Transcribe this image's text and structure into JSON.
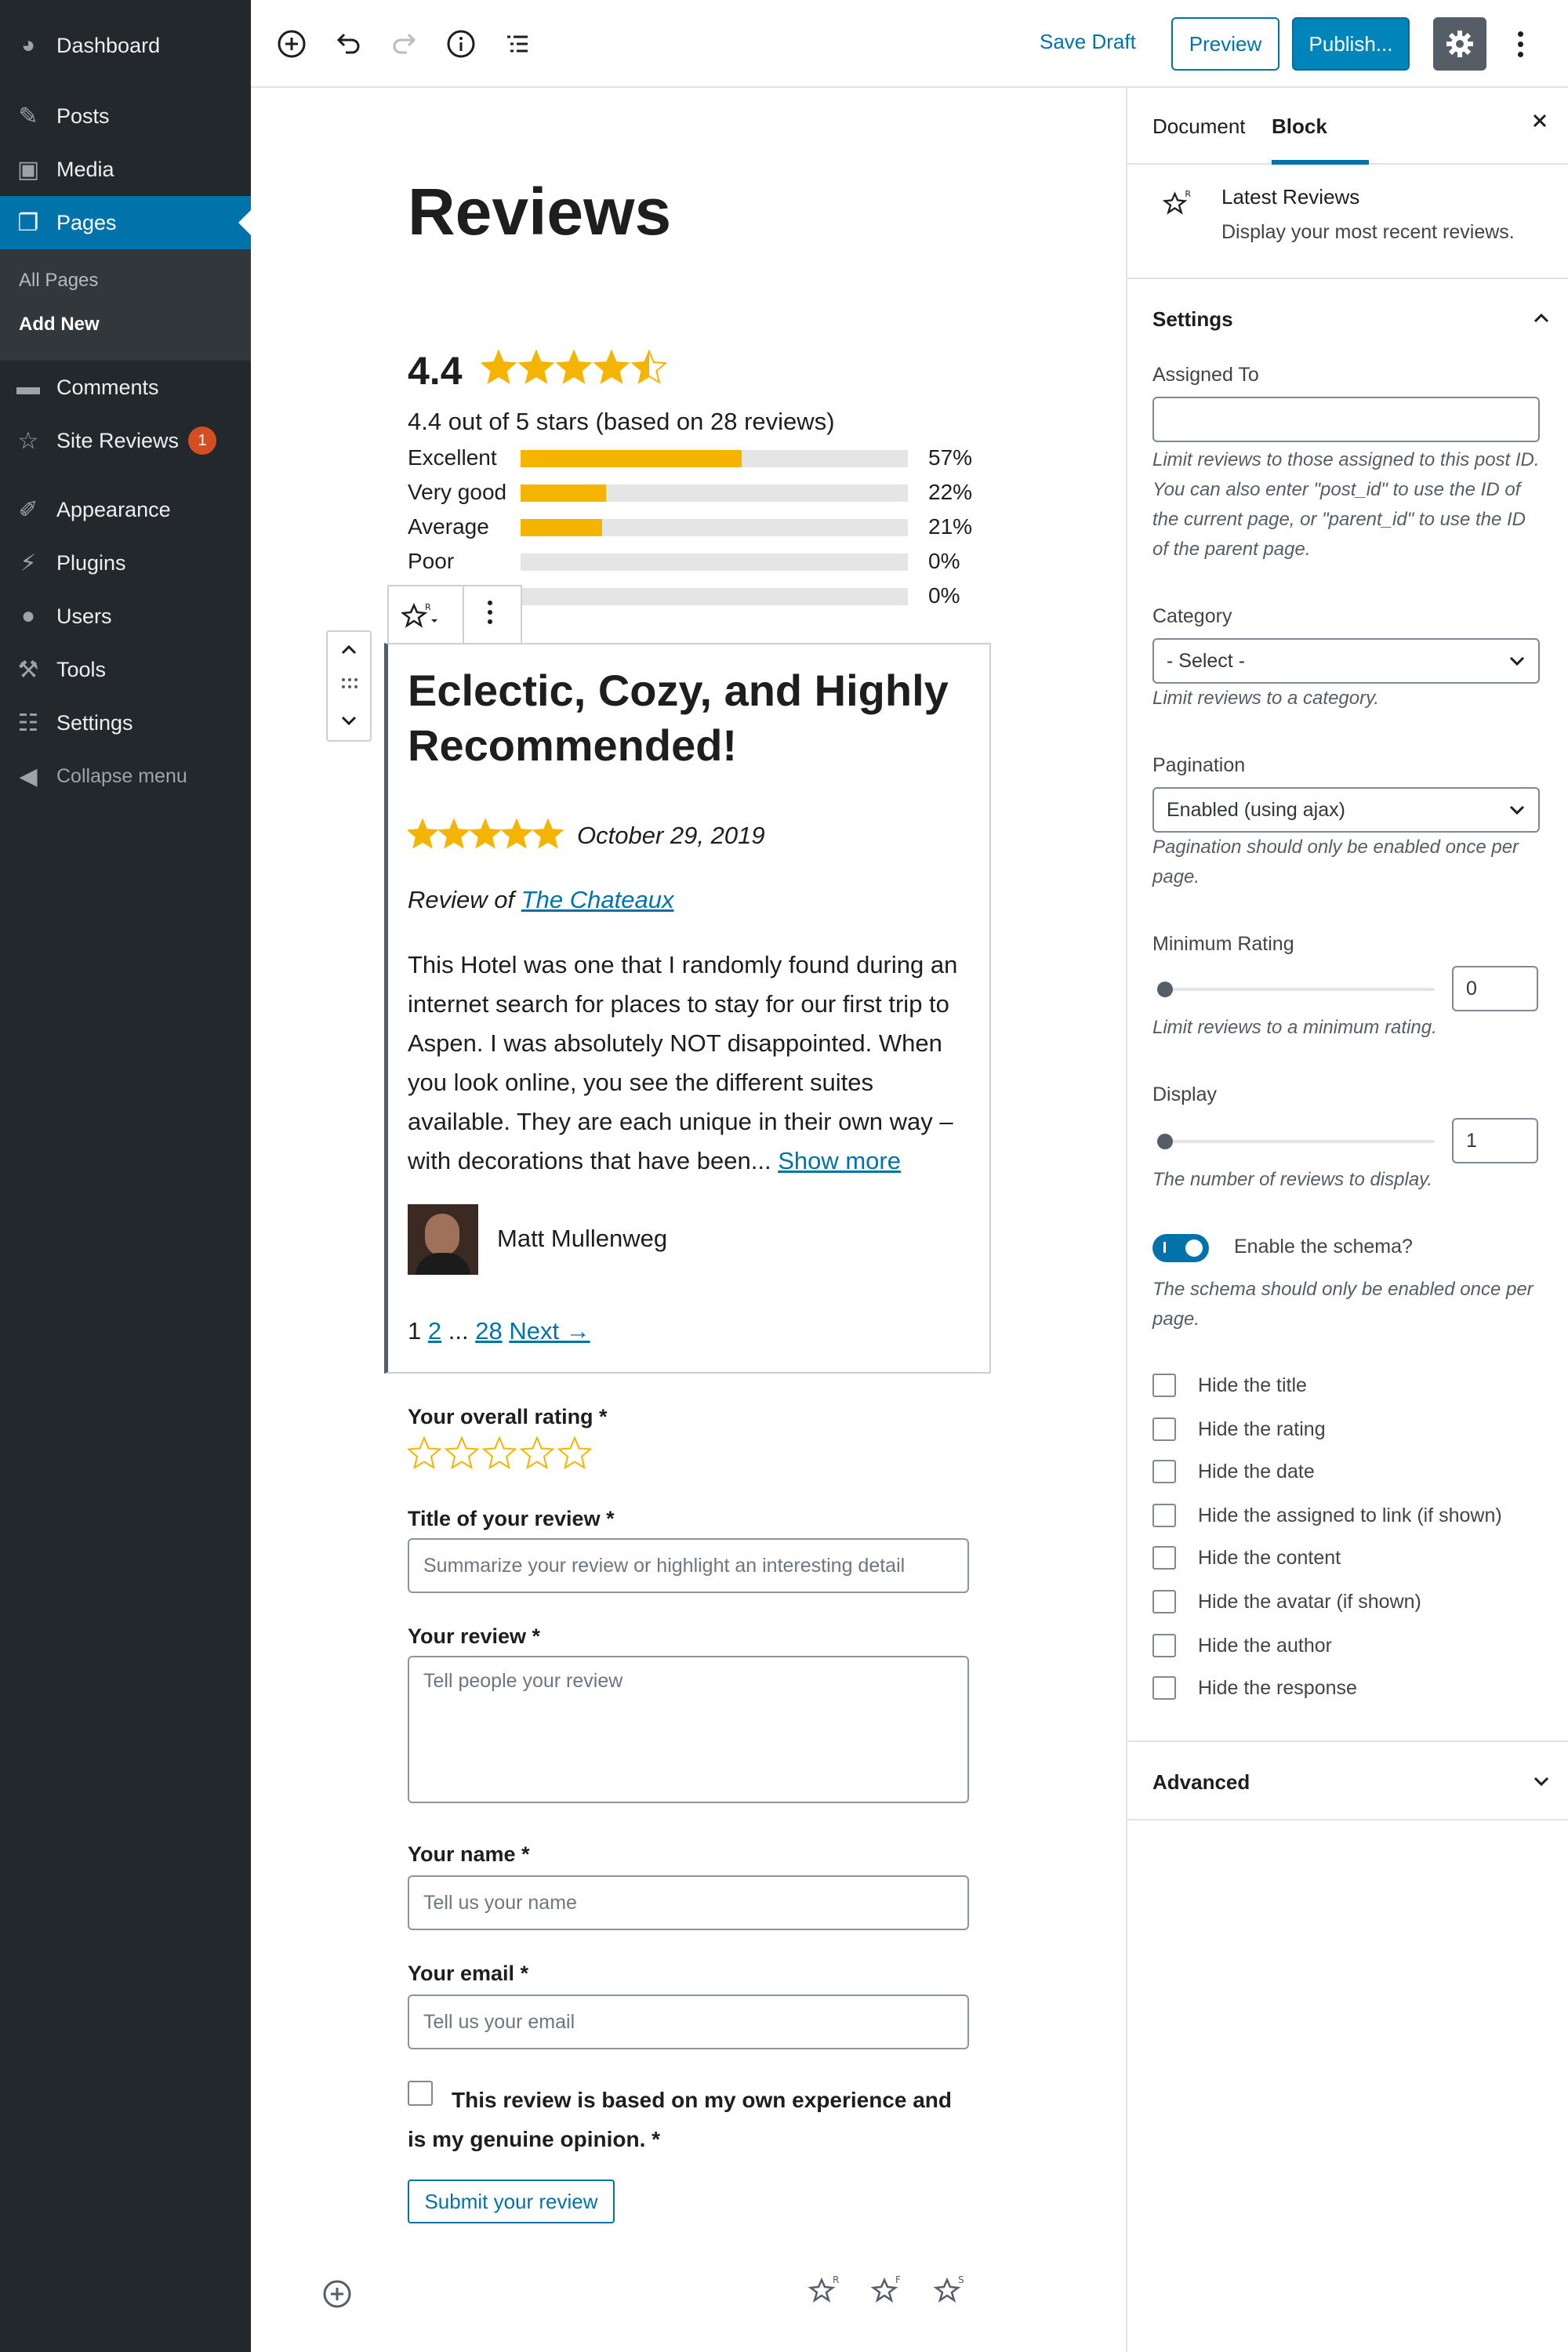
{
  "sidebar": {
    "items": [
      {
        "label": "Dashboard",
        "icon": "dashboard-icon"
      },
      {
        "label": "Posts",
        "icon": "pin-icon"
      },
      {
        "label": "Media",
        "icon": "media-icon"
      },
      {
        "label": "Pages",
        "icon": "pages-icon"
      },
      {
        "label": "Comments",
        "icon": "comment-icon"
      },
      {
        "label": "Site Reviews",
        "icon": "star-icon",
        "badge": "1"
      },
      {
        "label": "Appearance",
        "icon": "brush-icon"
      },
      {
        "label": "Plugins",
        "icon": "plug-icon"
      },
      {
        "label": "Users",
        "icon": "user-icon"
      },
      {
        "label": "Tools",
        "icon": "wrench-icon"
      },
      {
        "label": "Settings",
        "icon": "sliders-icon"
      },
      {
        "label": "Collapse menu",
        "icon": "collapse-icon"
      }
    ],
    "submenu": [
      "All Pages",
      "Add New"
    ]
  },
  "toolbar": {
    "save_draft": "Save Draft",
    "preview": "Preview",
    "publish": "Publish..."
  },
  "page": {
    "title": "Reviews"
  },
  "summary": {
    "rating": "4.4",
    "stars": 4.4,
    "text": "4.4 out of 5 stars (based on 28 reviews)",
    "bars": [
      {
        "label": "Excellent",
        "value": 57,
        "pct": "57%"
      },
      {
        "label": "Very good",
        "value": 22,
        "pct": "22%"
      },
      {
        "label": "Average",
        "value": 21,
        "pct": "21%"
      },
      {
        "label": "Poor",
        "value": 0,
        "pct": "0%"
      },
      {
        "label": "",
        "value": 0,
        "pct": "0%"
      }
    ]
  },
  "review": {
    "title": "Eclectic, Cozy, and Highly Recommended!",
    "stars": 5,
    "date": "October 29, 2019",
    "review_of_prefix": "Review of",
    "review_of_link": "The Chateaux",
    "body": "This Hotel was one that I randomly found during an internet search for places to stay for our first trip to Aspen. I was absolutely NOT disappointed. When you look online, you see the different suites available. They are each unique in their own way – with decorations that have been...",
    "show_more": "Show more",
    "author": "Matt Mullenweg"
  },
  "pagination": {
    "current": "1",
    "page2": "2",
    "ellipsis": "...",
    "last": "28",
    "next": "Next →"
  },
  "form": {
    "rating_label": "Your overall rating *",
    "title_label": "Title of your review *",
    "title_placeholder": "Summarize your review or highlight an interesting detail",
    "review_label": "Your review *",
    "review_placeholder": "Tell people your review",
    "name_label": "Your name *",
    "name_placeholder": "Tell us your name",
    "email_label": "Your email *",
    "email_placeholder": "Tell us your email",
    "consent": "This review is based on my own experience and is my genuine opinion. *",
    "submit": "Submit your review"
  },
  "panel": {
    "tabs": [
      "Document",
      "Block"
    ],
    "block_name": "Latest Reviews",
    "block_desc": "Display your most recent reviews.",
    "settings_title": "Settings",
    "assigned_label": "Assigned To",
    "assigned_value": "",
    "assigned_help": "Limit reviews to those assigned to this post ID. You can also enter \"post_id\" to use the ID of the current page, or \"parent_id\" to use the ID of the parent page.",
    "category_label": "Category",
    "category_value": "- Select -",
    "category_help": "Limit reviews to a category.",
    "pagination_label": "Pagination",
    "pagination_value": "Enabled (using ajax)",
    "pagination_help": "Pagination should only be enabled once per page.",
    "min_rating_label": "Minimum Rating",
    "min_rating_value": "0",
    "min_rating_help": "Limit reviews to a minimum rating.",
    "display_label": "Display",
    "display_value": "1",
    "display_help": "The number of reviews to display.",
    "schema_label": "Enable the schema?",
    "schema_enabled": true,
    "schema_help": "The schema should only be enabled once per page.",
    "checks": [
      "Hide the title",
      "Hide the rating",
      "Hide the date",
      "Hide the assigned to link (if shown)",
      "Hide the content",
      "Hide the avatar (if shown)",
      "Hide the author",
      "Hide the response"
    ],
    "advanced_title": "Advanced"
  },
  "colors": {
    "accent": "#0073aa",
    "star": "#f4b400",
    "sidebar": "#23282d"
  }
}
